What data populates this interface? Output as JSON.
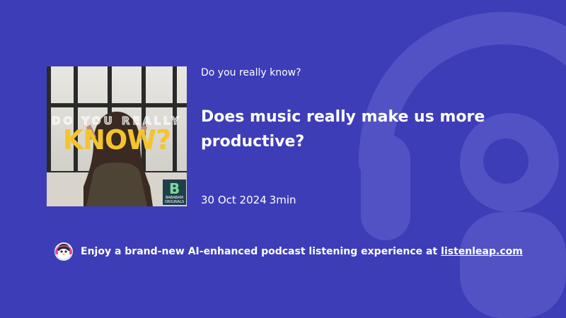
{
  "episode": {
    "show_name": "Do you really know?",
    "title": "Does music really make us more productive?",
    "date": "30 Oct 2024",
    "duration": "3min"
  },
  "cover_art": {
    "line1": "DO YOU REALLY",
    "line2": "KNOW?",
    "badge_line1": "BABABAM",
    "badge_line2": "ORIGINALS"
  },
  "promo": {
    "text": "Enjoy a brand-new AI-enhanced podcast listening experience at",
    "link_label": "listenleap.com"
  },
  "colors": {
    "background": "#3d3db8",
    "cover_title_yellow": "#f4c430",
    "badge_bg": "#1f3f4a"
  },
  "icons": {
    "background": "headphones-watermark-icon",
    "promo": "penguin-avatar-icon"
  }
}
